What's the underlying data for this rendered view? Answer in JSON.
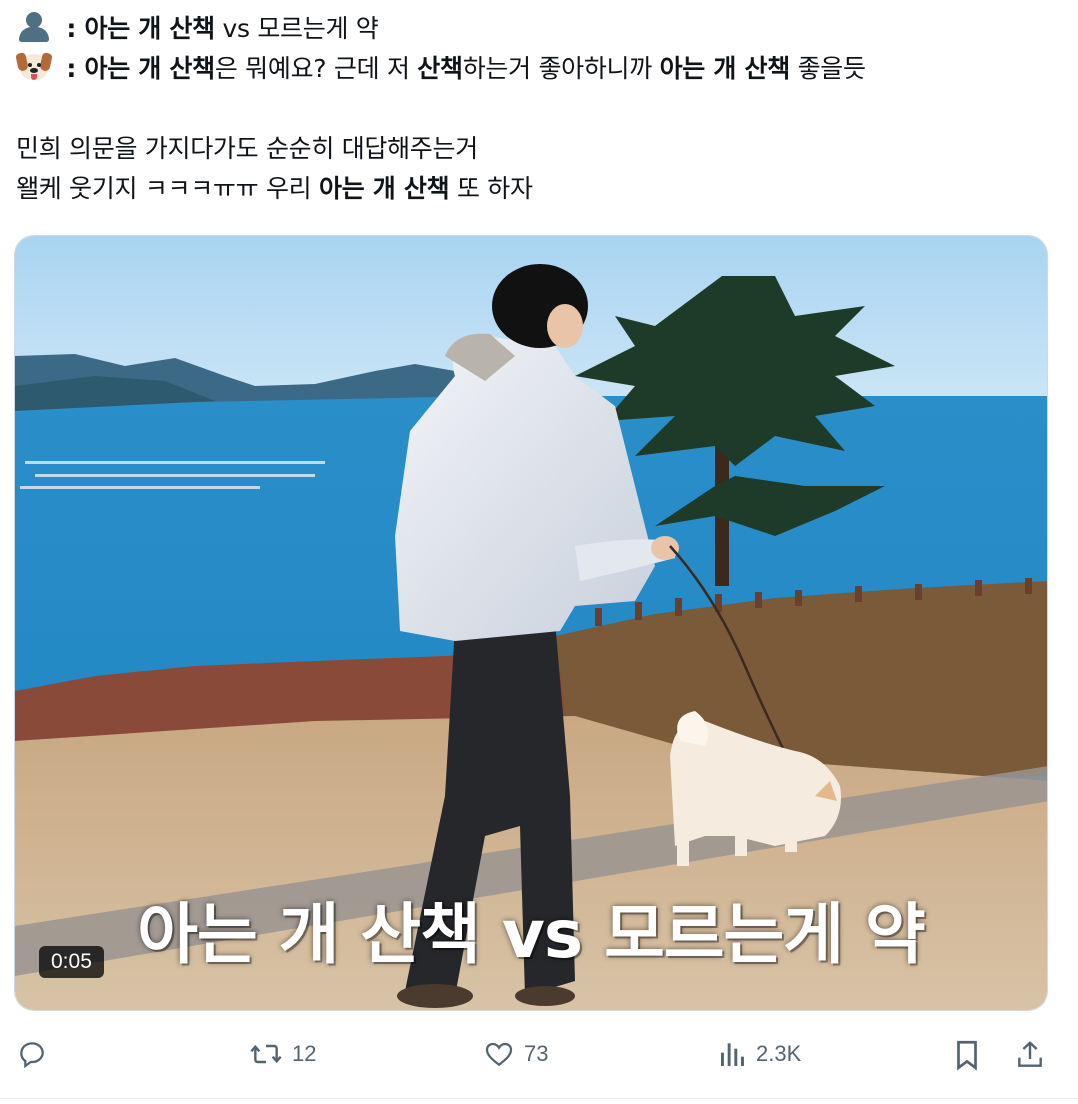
{
  "tweet": {
    "lines": [
      {
        "speaker_icon": "person-icon",
        "parts": [
          {
            "text": " : ",
            "bold": true
          },
          {
            "text": "아는 개 산책",
            "bold": true
          },
          {
            "text": " vs 모르는게 약",
            "bold": false
          }
        ]
      },
      {
        "speaker_icon": "dog-face-icon",
        "parts": [
          {
            "text": " : ",
            "bold": true
          },
          {
            "text": "아는 개 산책",
            "bold": true
          },
          {
            "text": "은 뭐예요? 근데 저 ",
            "bold": false
          },
          {
            "text": "산책",
            "bold": true
          },
          {
            "text": "하는거 좋아하니까 ",
            "bold": false
          },
          {
            "text": "아는 개 산책",
            "bold": true
          },
          {
            "text": " 좋을듯",
            "bold": false
          }
        ]
      }
    ],
    "paragraph": [
      [
        {
          "text": "민희 의문을 가지다가도 순순히 대답해주는거",
          "bold": false
        }
      ],
      [
        {
          "text": "왤케 웃기지 ㅋㅋㅋㅠㅠ  우리 ",
          "bold": false
        },
        {
          "text": "아는 개 산책",
          "bold": true
        },
        {
          "text": " 또 하자",
          "bold": false
        }
      ]
    ]
  },
  "video": {
    "caption": "아는 개 산책 vs 모르는게 약",
    "timestamp": "0:05"
  },
  "actions": {
    "reply": {
      "icon": "reply-icon",
      "count": ""
    },
    "retweet": {
      "icon": "retweet-icon",
      "count": "12"
    },
    "like": {
      "icon": "heart-icon",
      "count": "73"
    },
    "views": {
      "icon": "views-icon",
      "count": "2.3K"
    },
    "bookmark": {
      "icon": "bookmark-icon"
    },
    "share": {
      "icon": "share-icon"
    }
  },
  "colors": {
    "text": "#0f1419",
    "muted": "#536471",
    "border": "#cfd9de"
  }
}
